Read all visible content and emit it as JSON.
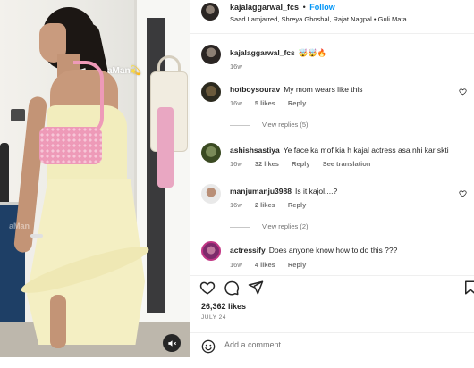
{
  "media": {
    "watermark": "aMan💫",
    "watermark_secondary": "aMan",
    "mute_icon": "speaker-muted-icon"
  },
  "header": {
    "username": "kajalaggarwal_fcs",
    "separator": "•",
    "follow_label": "Follow",
    "audio": "Saad Lamjarred, Shreya Ghoshal, Rajat Nagpal • Guli Mata"
  },
  "comments": [
    {
      "username": "kajalaggarwal_fcs",
      "text": "🤯🤯🔥",
      "time": "16w",
      "likes": "",
      "reply": "",
      "extra": "",
      "view_replies": ""
    },
    {
      "username": "hotboysourav",
      "text": "My mom wears like this",
      "time": "16w",
      "likes": "5 likes",
      "reply": "Reply",
      "extra": "",
      "view_replies": "View replies (5)"
    },
    {
      "username": "ashishsastiya",
      "text": "Ye face ka mof kia h kajal actress asa nhi kar skti",
      "time": "16w",
      "likes": "32 likes",
      "reply": "Reply",
      "extra": "See translation",
      "view_replies": ""
    },
    {
      "username": "manjumanju3988",
      "text": "Is it kajol....?",
      "time": "16w",
      "likes": "2 likes",
      "reply": "Reply",
      "extra": "",
      "view_replies": "View replies (2)"
    },
    {
      "username": "actressify",
      "text": "Does anyone know how to do this ???",
      "time": "16w",
      "likes": "4 likes",
      "reply": "Reply",
      "extra": "",
      "view_replies": ""
    }
  ],
  "actions": {
    "like_icon": "heart-icon",
    "comment_icon": "comment-icon",
    "share_icon": "share-icon",
    "save_icon": "bookmark-icon"
  },
  "likes_count": "26,362 likes",
  "date": "JULY 24",
  "add_comment": {
    "placeholder": "Add a comment...",
    "emoji_icon": "emoji-icon"
  },
  "colors": {
    "accent": "#0095f6",
    "text": "#262626",
    "muted": "#737373",
    "border": "#efefef"
  }
}
